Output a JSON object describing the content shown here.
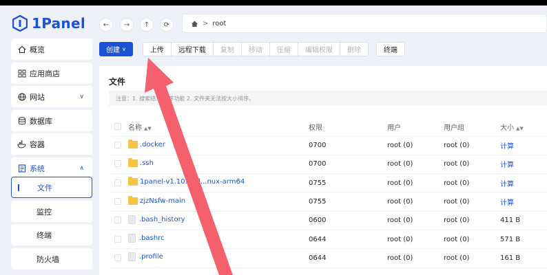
{
  "app": {
    "logo_text": "1Panel"
  },
  "sidebar": {
    "items": [
      {
        "label": "概览",
        "icon": "home-icon"
      },
      {
        "label": "应用商店",
        "icon": "grid-icon"
      },
      {
        "label": "网站",
        "icon": "globe-icon"
      },
      {
        "label": "数据库",
        "icon": "database-icon"
      },
      {
        "label": "容器",
        "icon": "container-icon"
      },
      {
        "label": "系统",
        "icon": "system-icon"
      }
    ],
    "sub_items": [
      {
        "label": "文件"
      },
      {
        "label": "监控"
      },
      {
        "label": "终端"
      },
      {
        "label": "防火墙"
      }
    ]
  },
  "pathbar": {
    "segment": "root"
  },
  "toolbar": {
    "create_label": "创建",
    "upload": "上传",
    "remote_download": "远程下载",
    "copy": "复制",
    "move": "移动",
    "compress": "压缩",
    "permission": "编辑权限",
    "delete": "删除",
    "terminal": "终端"
  },
  "card": {
    "title": "文件",
    "notice": "注意：1. 搜索结... 排序功能 2. 文件夹无法按大小排序。"
  },
  "table": {
    "headers": {
      "name": "名称",
      "permission": "权限",
      "user": "用户",
      "group": "用户组",
      "size": "大小"
    },
    "rows": [
      {
        "name": ".docker",
        "type": "folder",
        "perm": "0700",
        "user": "root (0)",
        "group": "root (0)",
        "size": "计算"
      },
      {
        "name": ".ssh",
        "type": "folder",
        "perm": "0700",
        "user": "root (0)",
        "group": "root (0)",
        "size": "计算"
      },
      {
        "name": "1panel-v1.10.21-l...nux-arm64",
        "type": "folder",
        "perm": "0755",
        "user": "root (0)",
        "group": "root (0)",
        "size": "计算"
      },
      {
        "name": "zjzNsfw-main",
        "type": "folder",
        "perm": "0755",
        "user": "root (0)",
        "group": "root (0)",
        "size": "计算"
      },
      {
        "name": ".bash_history",
        "type": "file",
        "perm": "0600",
        "user": "root (0)",
        "group": "root (0)",
        "size": "411 B"
      },
      {
        "name": ".bashrc",
        "type": "file",
        "perm": "0644",
        "user": "root (0)",
        "group": "root (0)",
        "size": "571 B"
      },
      {
        "name": ".profile",
        "type": "file",
        "perm": "0644",
        "user": "root (0)",
        "group": "root (0)",
        "size": "161 B"
      }
    ]
  },
  "colors": {
    "accent": "#1c53d6",
    "arrow": "#f4606c",
    "folder": "#f6c445"
  }
}
